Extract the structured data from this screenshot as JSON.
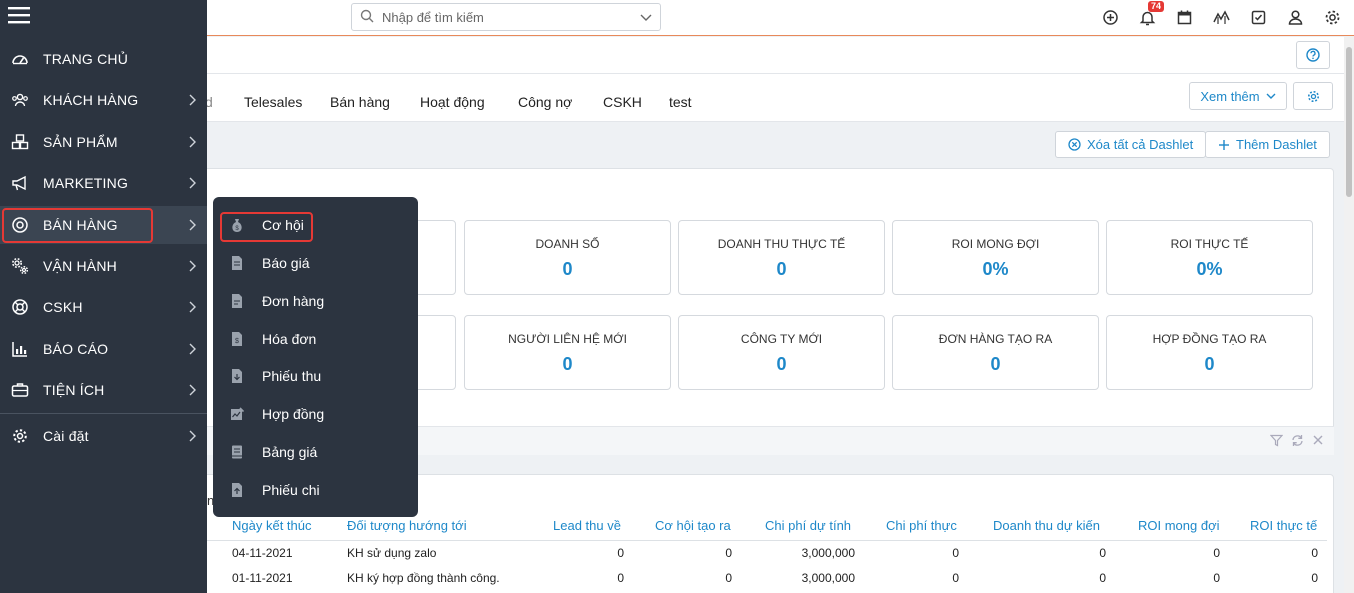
{
  "search": {
    "placeholder": "Nhập để tìm kiếm"
  },
  "notifications": {
    "count": "74"
  },
  "tabs": {
    "cut_label": "d",
    "items": [
      "Telesales",
      "Bán hàng",
      "Hoạt động",
      "Công nợ",
      "CSKH",
      "test"
    ]
  },
  "toolbar": {
    "more_label": "Xem thêm",
    "clear_dashlets": "Xóa tất cả Dashlet",
    "add_dashlet": "Thêm Dashlet"
  },
  "cards_row1": [
    {
      "label": "DOANH SỐ",
      "value": "0"
    },
    {
      "label": "DOANH THU THỰC TẾ",
      "value": "0"
    },
    {
      "label": "ROI MONG ĐỢI",
      "value": "0%"
    },
    {
      "label": "ROI THỰC TẾ",
      "value": "0%"
    }
  ],
  "cards_row2": [
    {
      "label": "NGƯỜI LIÊN HỆ MỚI",
      "value": "0"
    },
    {
      "label": "CÔNG TY MỚI",
      "value": "0"
    },
    {
      "label": "ĐƠN HÀNG TẠO RA",
      "value": "0"
    },
    {
      "label": "HỢP ĐỒNG TẠO RA",
      "value": "0"
    }
  ],
  "table": {
    "cut_header": "n",
    "headers": [
      "Ngày kết thúc",
      "Đối tượng hướng tới",
      "Lead thu về",
      "Cơ hội tạo ra",
      "Chi phí dự tính",
      "Chi phí thực",
      "Doanh thu dự kiến",
      "ROI mong đợi",
      "ROI thực tế"
    ],
    "rows": [
      [
        "04-11-2021",
        "KH sử dụng zalo",
        "0",
        "0",
        "3,000,000",
        "0",
        "0",
        "0",
        "0"
      ],
      [
        "01-11-2021",
        "KH ký hợp đồng thành công.",
        "0",
        "0",
        "3,000,000",
        "0",
        "0",
        "0",
        "0"
      ]
    ]
  },
  "sidebar": {
    "items": [
      {
        "label": "TRANG CHỦ",
        "icon": "dashboard-icon"
      },
      {
        "label": "KHÁCH HÀNG",
        "icon": "users-icon"
      },
      {
        "label": "SẢN PHẨM",
        "icon": "boxes-icon"
      },
      {
        "label": "MARKETING",
        "icon": "megaphone-icon"
      },
      {
        "label": "BÁN HÀNG",
        "icon": "target-icon"
      },
      {
        "label": "VẬN HÀNH",
        "icon": "cogs-icon"
      },
      {
        "label": "CSKH",
        "icon": "lifebuoy-icon"
      },
      {
        "label": "BÁO CÁO",
        "icon": "bar-chart-icon"
      },
      {
        "label": "TIỆN ÍCH",
        "icon": "briefcase-icon"
      },
      {
        "label": "Cài đặt",
        "icon": "gear-icon"
      }
    ]
  },
  "submenu": {
    "items": [
      {
        "label": "Cơ hội",
        "icon": "money-bag-icon"
      },
      {
        "label": "Báo giá",
        "icon": "document-icon"
      },
      {
        "label": "Đơn hàng",
        "icon": "order-document-icon"
      },
      {
        "label": "Hóa đơn",
        "icon": "invoice-icon"
      },
      {
        "label": "Phiếu thu",
        "icon": "receipt-in-icon"
      },
      {
        "label": "Hợp đồng",
        "icon": "contract-icon"
      },
      {
        "label": "Bảng giá",
        "icon": "price-book-icon"
      },
      {
        "label": "Phiếu chi",
        "icon": "receipt-out-icon"
      }
    ]
  },
  "colors": {
    "sidebar_bg": "#2c3440",
    "accent": "#1e88c9",
    "highlight": "#e53935",
    "topbar_line": "#e8895a"
  }
}
